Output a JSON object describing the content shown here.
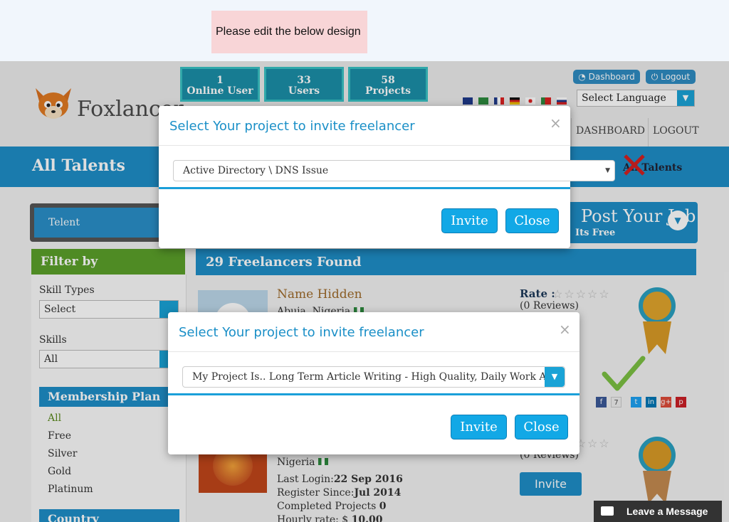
{
  "note": "Please edit the below design",
  "header": {
    "brand": "Foxlancer",
    "stats": [
      {
        "value": "1",
        "label": "Online User"
      },
      {
        "value": "33",
        "label": "Users"
      },
      {
        "value": "58",
        "label": "Projects"
      }
    ],
    "dashboard_pill": "Dashboard",
    "logout_pill": "Logout",
    "language_select": "Select Language",
    "nav": [
      "DASHBOARD",
      "LOGOUT"
    ]
  },
  "page": {
    "title": "All Talents",
    "breadcrumb": "All Talents",
    "search_value": "Telent",
    "post_job": "Post Your Job",
    "post_job_sub": "Its Free"
  },
  "filter": {
    "title": "Filter by",
    "skill_types_label": "Skill Types",
    "skill_types_value": "Select",
    "skills_label": "Skills",
    "skills_value": "All",
    "membership_title": "Membership Plan",
    "plans": [
      "All",
      "Free",
      "Silver",
      "Gold",
      "Platinum"
    ],
    "country_title": "Country"
  },
  "results": {
    "count_label": "29 Freelancers Found",
    "card1": {
      "name": "Name Hidden",
      "location": "Abuja, Nigeria",
      "rate_label": "Rate :",
      "reviews": "(0 Reviews)",
      "share_count": "7"
    },
    "card2": {
      "location": "Nigeria",
      "last_login_label": "Last Login:",
      "last_login": "22 Sep 2016",
      "register_label": "Register Since:",
      "register": "Jul 2014",
      "completed_label": "Completed Projects",
      "completed": "0",
      "hourly_label": "Hourly rate: $",
      "hourly": "10.00",
      "reviews": "(0 Reviews)",
      "invite": "Invite"
    }
  },
  "modal_top": {
    "title": "Select Your project to invite freelancer",
    "close_x": "×",
    "selected_project": "Active Directory \\ DNS Issue",
    "invite": "Invite",
    "close": "Close"
  },
  "modal_bottom": {
    "title": "Select Your project to invite freelancer",
    "close_x": "×",
    "selected_project": "My Project Is.. Long Term Article Writing - High Quality, Daily Work And Daily",
    "invite": "Invite",
    "close": "Close"
  },
  "chat": {
    "label": "Leave a Message"
  },
  "colors": {
    "accent": "#1a8fc7",
    "button": "#12a8e6",
    "filter_green": "#5ba02a"
  }
}
